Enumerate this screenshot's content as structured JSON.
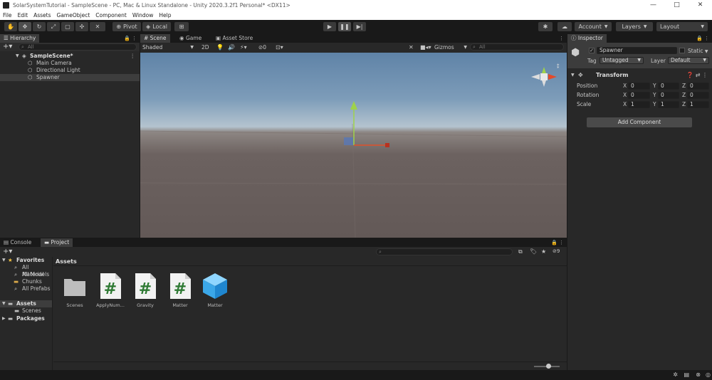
{
  "window": {
    "title": "SolarSystemTutorial - SampleScene - PC, Mac & Linux Standalone - Unity 2020.3.2f1 Personal* <DX11>",
    "minimize": "—",
    "maximize": "□",
    "close": "✕"
  },
  "menu": [
    "File",
    "Edit",
    "Assets",
    "GameObject",
    "Component",
    "Window",
    "Help"
  ],
  "toolbar": {
    "pivot": "Pivot",
    "local": "Local",
    "account": "Account",
    "layers": "Layers",
    "layout": "Layout"
  },
  "hierarchy": {
    "tab": "Hierarchy",
    "search_placeholder": "All",
    "scene": "SampleScene*",
    "items": [
      "Main Camera",
      "Directional Light",
      "Spawner"
    ]
  },
  "scene": {
    "tabs": [
      "Scene",
      "Game",
      "Asset Store"
    ],
    "shading": "Shaded",
    "mode_2d": "2D",
    "gizmos": "Gizmos",
    "search_placeholder": "All",
    "hidden_count": "0"
  },
  "inspector": {
    "tab": "Inspector",
    "object_name": "Spawner",
    "static_label": "Static",
    "tag_label": "Tag",
    "tag_value": "Untagged",
    "layer_label": "Layer",
    "layer_value": "Default",
    "component": "Transform",
    "rows": [
      {
        "label": "Position",
        "x": "0",
        "y": "0",
        "z": "0"
      },
      {
        "label": "Rotation",
        "x": "0",
        "y": "0",
        "z": "0"
      },
      {
        "label": "Scale",
        "x": "1",
        "y": "1",
        "z": "1"
      }
    ],
    "axis_x": "X",
    "axis_y": "Y",
    "axis_z": "Z",
    "add_component": "Add Component"
  },
  "project": {
    "tabs": [
      "Console",
      "Project"
    ],
    "favorites_label": "Favorites",
    "favorites": [
      "All Material",
      "All Models",
      "Chunks",
      "All Prefabs"
    ],
    "assets_label": "Assets",
    "asset_children": [
      "Scenes"
    ],
    "packages_label": "Packages",
    "breadcrumb": "Assets",
    "hidden_count": "9",
    "assets": [
      {
        "name": "Scenes",
        "kind": "folder-icon"
      },
      {
        "name": "ApplyNum...",
        "kind": "script-icon"
      },
      {
        "name": "Gravity",
        "kind": "script-icon"
      },
      {
        "name": "Matter",
        "kind": "script-icon"
      },
      {
        "name": "Matter",
        "kind": "prefab-icon"
      }
    ]
  }
}
